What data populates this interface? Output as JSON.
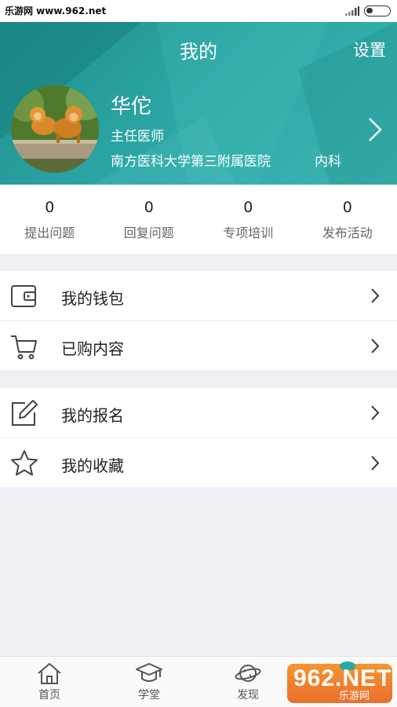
{
  "status_bar": {
    "site": "乐游网 www.962.net"
  },
  "header": {
    "title": "我的",
    "settings_label": "设置",
    "user": {
      "name": "华佗",
      "title": "主任医师",
      "hospital": "南方医科大学第三附属医院",
      "department": "内科"
    }
  },
  "stats": [
    {
      "value": "0",
      "label": "提出问题"
    },
    {
      "value": "0",
      "label": "回复问题"
    },
    {
      "value": "0",
      "label": "专项培训"
    },
    {
      "value": "0",
      "label": "发布活动"
    }
  ],
  "menu_group_1": [
    {
      "label": "我的钱包",
      "icon": "wallet-icon"
    },
    {
      "label": "已购内容",
      "icon": "cart-icon"
    }
  ],
  "menu_group_2": [
    {
      "label": "我的报名",
      "icon": "edit-icon"
    },
    {
      "label": "我的收藏",
      "icon": "star-icon"
    }
  ],
  "bottom_nav": [
    {
      "label": "首页",
      "icon": "home-icon"
    },
    {
      "label": "学堂",
      "icon": "graduation-cap-icon"
    },
    {
      "label": "发现",
      "icon": "planet-icon"
    }
  ],
  "watermark": {
    "logo_text": "962.NET",
    "site_name": "乐游网"
  },
  "colors": {
    "header": "#2ba5a3",
    "background": "#f0eff5",
    "watermark": "#f07a1e"
  }
}
